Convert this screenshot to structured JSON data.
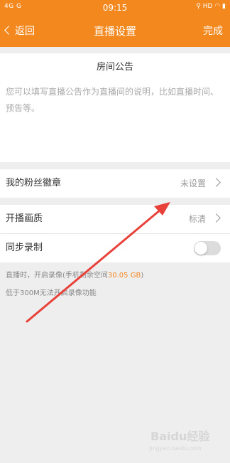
{
  "status_bar": {
    "network": "4G  G",
    "time": "09:15",
    "indicators": "HD"
  },
  "nav": {
    "back_label": "返回",
    "title": "直播设置",
    "done_label": "完成"
  },
  "announcement": {
    "title": "房间公告",
    "placeholder": "您可以填写直播公告作为直播间的说明，比如直播时间、预告等。"
  },
  "settings": {
    "fan_badge": {
      "label": "我的粉丝徽章",
      "value": "未设置"
    },
    "quality": {
      "label": "开播画质",
      "value": "标清"
    },
    "sync_record": {
      "label": "同步录制",
      "enabled": false
    }
  },
  "notes": {
    "line1_prefix": "直播时，开启录像(手机剩余空间",
    "storage": "30.05 GB",
    "line1_suffix": ")",
    "line2": "低于300M无法开启录像功能"
  },
  "watermark": {
    "text": "Baidu经验",
    "sub": "jingyan.baidu.com"
  },
  "colors": {
    "accent": "#f3881e",
    "annotation_arrow": "#e8413a"
  }
}
